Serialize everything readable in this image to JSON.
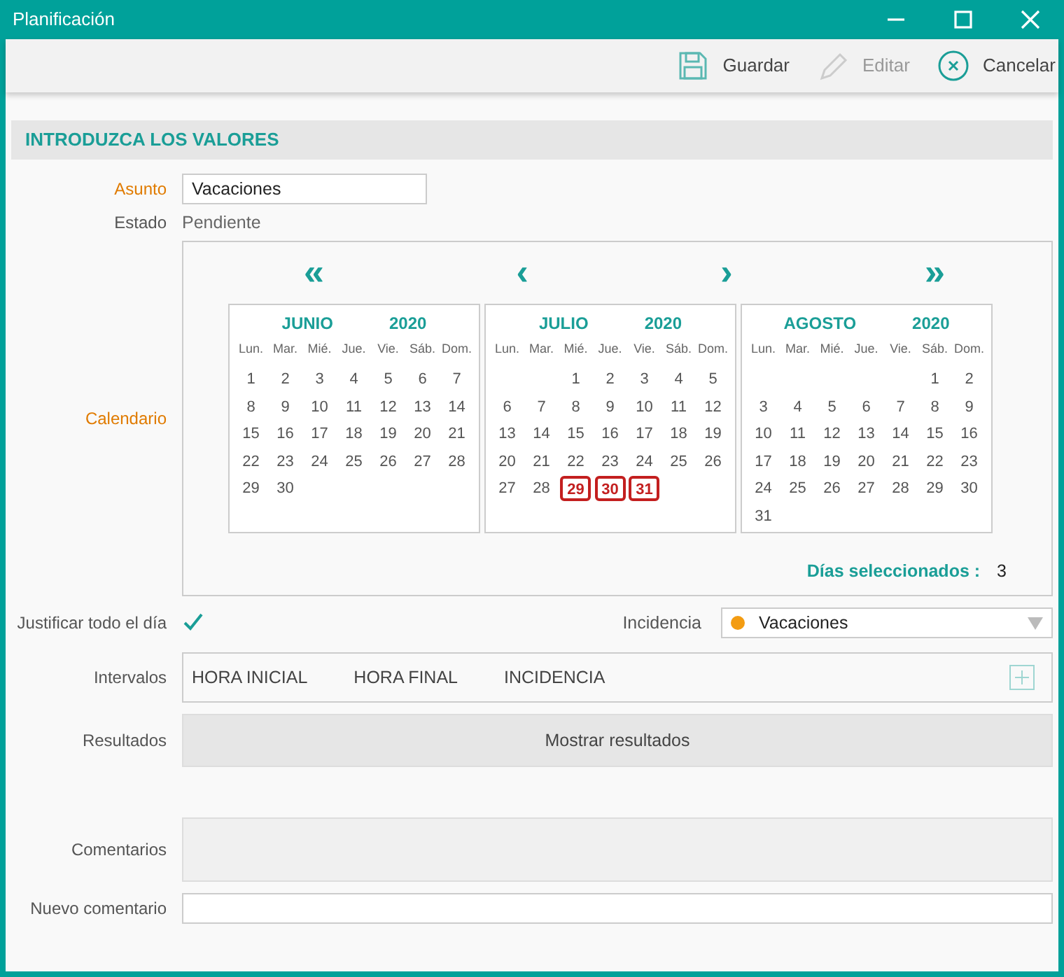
{
  "window": {
    "title": "Planificación"
  },
  "toolbar": [
    {
      "label": "Guardar",
      "kind": "save",
      "disabled": false
    },
    {
      "label": "Editar",
      "kind": "edit",
      "disabled": true
    },
    {
      "label": "Cancelar",
      "kind": "cancel",
      "disabled": false
    }
  ],
  "section": {
    "title": "INTRODUZCA LOS VALORES"
  },
  "asunto": {
    "label": "Asunto",
    "required": true,
    "value": "Vacaciones"
  },
  "estado": {
    "label": "Estado",
    "required": false,
    "value": "Pendiente"
  },
  "calendar": {
    "label": "Calendario",
    "required": true,
    "nav": [
      "«",
      "‹",
      "›",
      "»"
    ],
    "months": [
      {
        "name": "JUNIO",
        "year": "2020",
        "weekdays": [
          "Lun.",
          "Mar.",
          "Mié.",
          "Jue.",
          "Vie.",
          "Sáb.",
          "Dom."
        ],
        "weeks": [
          [
            {
              "n": "1",
              "selected": false
            },
            {
              "n": "2",
              "selected": false
            },
            {
              "n": "3",
              "selected": false
            },
            {
              "n": "4",
              "selected": false
            },
            {
              "n": "5",
              "selected": false
            },
            {
              "n": "6",
              "selected": false
            },
            {
              "n": "7",
              "selected": false
            }
          ],
          [
            {
              "n": "8",
              "selected": false
            },
            {
              "n": "9",
              "selected": false
            },
            {
              "n": "10",
              "selected": false
            },
            {
              "n": "11",
              "selected": false
            },
            {
              "n": "12",
              "selected": false
            },
            {
              "n": "13",
              "selected": false
            },
            {
              "n": "14",
              "selected": false
            }
          ],
          [
            {
              "n": "15",
              "selected": false
            },
            {
              "n": "16",
              "selected": false
            },
            {
              "n": "17",
              "selected": false
            },
            {
              "n": "18",
              "selected": false
            },
            {
              "n": "19",
              "selected": false
            },
            {
              "n": "20",
              "selected": false
            },
            {
              "n": "21",
              "selected": false
            }
          ],
          [
            {
              "n": "22",
              "selected": false
            },
            {
              "n": "23",
              "selected": false
            },
            {
              "n": "24",
              "selected": false
            },
            {
              "n": "25",
              "selected": false
            },
            {
              "n": "26",
              "selected": false
            },
            {
              "n": "27",
              "selected": false
            },
            {
              "n": "28",
              "selected": false
            }
          ],
          [
            {
              "n": "29",
              "selected": false
            },
            {
              "n": "30",
              "selected": false
            }
          ]
        ]
      },
      {
        "name": "JULIO",
        "year": "2020",
        "weekdays": [
          "Lun.",
          "Mar.",
          "Mié.",
          "Jue.",
          "Vie.",
          "Sáb.",
          "Dom."
        ],
        "weeks": [
          [
            {
              "n": "1",
              "selected": false
            },
            {
              "n": "2",
              "selected": false
            },
            {
              "n": "3",
              "selected": false
            },
            {
              "n": "4",
              "selected": false
            },
            {
              "n": "5",
              "selected": false
            }
          ],
          [
            {
              "n": "6",
              "selected": false
            },
            {
              "n": "7",
              "selected": false
            },
            {
              "n": "8",
              "selected": false
            },
            {
              "n": "9",
              "selected": false
            },
            {
              "n": "10",
              "selected": false
            },
            {
              "n": "11",
              "selected": false
            },
            {
              "n": "12",
              "selected": false
            }
          ],
          [
            {
              "n": "13",
              "selected": false
            },
            {
              "n": "14",
              "selected": false
            },
            {
              "n": "15",
              "selected": false
            },
            {
              "n": "16",
              "selected": false
            },
            {
              "n": "17",
              "selected": false
            },
            {
              "n": "18",
              "selected": false
            },
            {
              "n": "19",
              "selected": false
            }
          ],
          [
            {
              "n": "20",
              "selected": false
            },
            {
              "n": "21",
              "selected": false
            },
            {
              "n": "22",
              "selected": false
            },
            {
              "n": "23",
              "selected": false
            },
            {
              "n": "24",
              "selected": false
            },
            {
              "n": "25",
              "selected": false
            },
            {
              "n": "26",
              "selected": false
            }
          ],
          [
            {
              "n": "27",
              "selected": false
            },
            {
              "n": "28",
              "selected": false
            },
            {
              "n": "29",
              "selected": true
            },
            {
              "n": "30",
              "selected": true
            },
            {
              "n": "31",
              "selected": true
            }
          ]
        ]
      },
      {
        "name": "AGOSTO",
        "year": "2020",
        "weekdays": [
          "Lun.",
          "Mar.",
          "Mié.",
          "Jue.",
          "Vie.",
          "Sáb.",
          "Dom."
        ],
        "weeks": [
          [
            {
              "n": "1",
              "selected": false
            },
            {
              "n": "2",
              "selected": false
            }
          ],
          [
            {
              "n": "3",
              "selected": false
            },
            {
              "n": "4",
              "selected": false
            },
            {
              "n": "5",
              "selected": false
            },
            {
              "n": "6",
              "selected": false
            },
            {
              "n": "7",
              "selected": false
            },
            {
              "n": "8",
              "selected": false
            },
            {
              "n": "9",
              "selected": false
            }
          ],
          [
            {
              "n": "10",
              "selected": false
            },
            {
              "n": "11",
              "selected": false
            },
            {
              "n": "12",
              "selected": false
            },
            {
              "n": "13",
              "selected": false
            },
            {
              "n": "14",
              "selected": false
            },
            {
              "n": "15",
              "selected": false
            },
            {
              "n": "16",
              "selected": false
            }
          ],
          [
            {
              "n": "17",
              "selected": false
            },
            {
              "n": "18",
              "selected": false
            },
            {
              "n": "19",
              "selected": false
            },
            {
              "n": "20",
              "selected": false
            },
            {
              "n": "21",
              "selected": false
            },
            {
              "n": "22",
              "selected": false
            },
            {
              "n": "23",
              "selected": false
            }
          ],
          [
            {
              "n": "24",
              "selected": false
            },
            {
              "n": "25",
              "selected": false
            },
            {
              "n": "26",
              "selected": false
            },
            {
              "n": "27",
              "selected": false
            },
            {
              "n": "28",
              "selected": false
            },
            {
              "n": "29",
              "selected": false
            },
            {
              "n": "30",
              "selected": false
            }
          ],
          [
            {
              "n": "31",
              "selected": false
            }
          ]
        ]
      }
    ],
    "count_label": "Días seleccionados :",
    "count": "3"
  },
  "justificar": {
    "label": "Justificar todo el día",
    "checked": true
  },
  "incidencia": {
    "label": "Incidencia",
    "value": "Vacaciones",
    "color": "#f39c12"
  },
  "intervalos": {
    "label": "Intervalos",
    "columns": [
      "HORA INICIAL",
      "HORA FINAL",
      "INCIDENCIA"
    ]
  },
  "resultados": {
    "label": "Resultados",
    "button": "Mostrar resultados"
  },
  "comentarios": {
    "label": "Comentarios"
  },
  "nuevo_comentario": {
    "label": "Nuevo comentario"
  }
}
